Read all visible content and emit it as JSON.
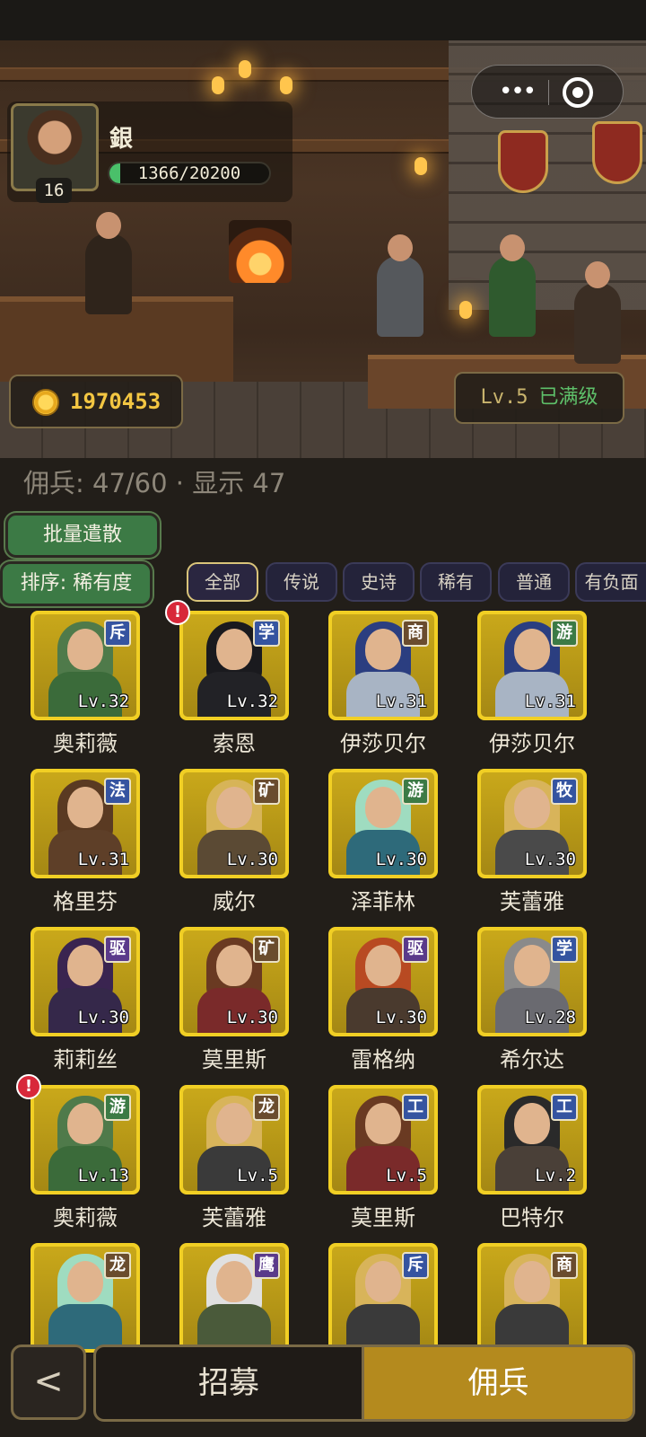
{
  "player": {
    "name": "銀",
    "level": "16",
    "xp_text": "1366/20200",
    "xp_fraction": 0.068
  },
  "gold": "1970453",
  "tavern": {
    "level": "Lv.5",
    "status": "已满级"
  },
  "roster": {
    "count_text": "佣兵: 47/60 · 显示 47"
  },
  "actions": {
    "batch_dismiss": "批量遣散",
    "sort": "排序: 稀有度"
  },
  "filters": [
    "全部",
    "传说",
    "史诗",
    "稀有",
    "普通",
    "有负面"
  ],
  "heroes": [
    {
      "name": "奥莉薇",
      "role": "斥",
      "level": "Lv.32",
      "role_color": "#3554a0",
      "alert": false
    },
    {
      "name": "索恩",
      "role": "学",
      "level": "Lv.32",
      "role_color": "#3554a0",
      "alert": true
    },
    {
      "name": "伊莎贝尔",
      "role": "商",
      "level": "Lv.31",
      "role_color": "#6a4c2e",
      "alert": false
    },
    {
      "name": "伊莎贝尔",
      "role": "游",
      "level": "Lv.31",
      "role_color": "#3c7a45",
      "alert": false
    },
    {
      "name": "格里芬",
      "role": "法",
      "level": "Lv.31",
      "role_color": "#3554a0",
      "alert": false
    },
    {
      "name": "威尔",
      "role": "矿",
      "level": "Lv.30",
      "role_color": "#6a4c2e",
      "alert": false
    },
    {
      "name": "泽菲林",
      "role": "游",
      "level": "Lv.30",
      "role_color": "#3c7a45",
      "alert": false
    },
    {
      "name": "芙蕾雅",
      "role": "牧",
      "level": "Lv.30",
      "role_color": "#3554a0",
      "alert": false
    },
    {
      "name": "莉莉丝",
      "role": "驱",
      "level": "Lv.30",
      "role_color": "#5a3a8a",
      "alert": false
    },
    {
      "name": "莫里斯",
      "role": "矿",
      "level": "Lv.30",
      "role_color": "#6a4c2e",
      "alert": false
    },
    {
      "name": "雷格纳",
      "role": "驱",
      "level": "Lv.30",
      "role_color": "#5a3a8a",
      "alert": false
    },
    {
      "name": "希尔达",
      "role": "学",
      "level": "Lv.28",
      "role_color": "#3554a0",
      "alert": false
    },
    {
      "name": "奥莉薇",
      "role": "游",
      "level": "Lv.13",
      "role_color": "#3c7a45",
      "alert": true
    },
    {
      "name": "芙蕾雅",
      "role": "龙",
      "level": "Lv.5",
      "role_color": "#6a4c2e",
      "alert": false
    },
    {
      "name": "莫里斯",
      "role": "工",
      "level": "Lv.5",
      "role_color": "#3554a0",
      "alert": false
    },
    {
      "name": "巴特尔",
      "role": "工",
      "level": "Lv.2",
      "role_color": "#3554a0",
      "alert": false
    },
    {
      "name": "",
      "role": "龙",
      "level": "",
      "role_color": "#6a4c2e",
      "alert": false
    },
    {
      "name": "",
      "role": "鹰",
      "level": "",
      "role_color": "#5a3a8a",
      "alert": false
    },
    {
      "name": "",
      "role": "斥",
      "level": "",
      "role_color": "#3554a0",
      "alert": false
    },
    {
      "name": "",
      "role": "商",
      "level": "",
      "role_color": "#6a4c2e",
      "alert": false
    }
  ],
  "nav": {
    "back": "<",
    "recruit": "招募",
    "mercenaries": "佣兵"
  },
  "colors": {
    "frame": "#f1cf24",
    "accent_green": "#3c7a45",
    "gold_text": "#f3c642",
    "active_tab": "#b48a1e"
  }
}
